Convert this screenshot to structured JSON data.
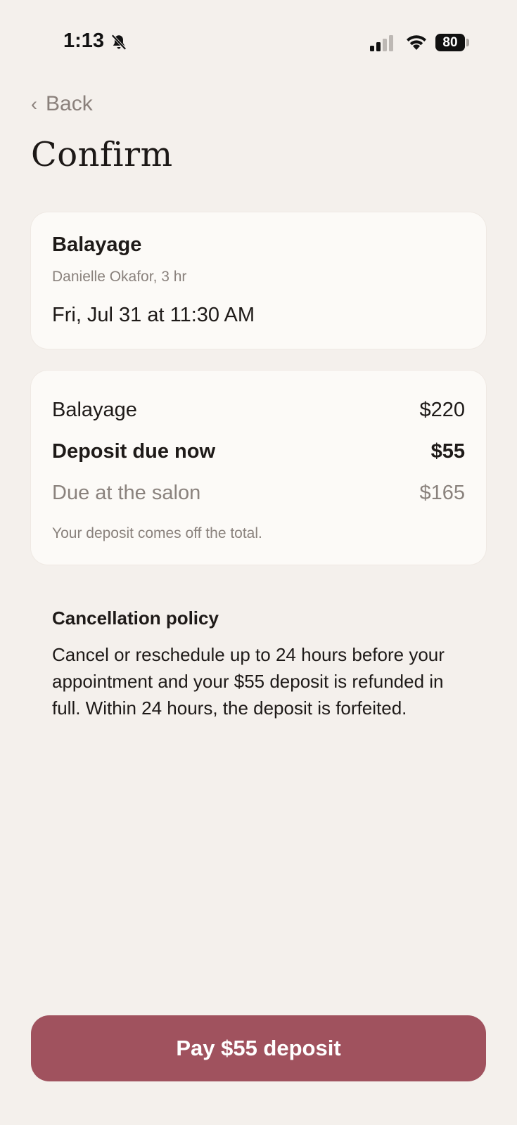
{
  "status": {
    "time": "1:13",
    "battery": "80",
    "icons": [
      "bell-slash-icon",
      "signal-icon",
      "wifi-icon",
      "battery-icon"
    ]
  },
  "nav": {
    "back_label": "Back"
  },
  "page": {
    "title": "Confirm"
  },
  "appointment": {
    "service": "Balayage",
    "stylist_line": "Danielle Okafor, 3 hr",
    "datetime": "Fri, Jul 31 at 11:30 AM"
  },
  "pricing": {
    "rows": [
      {
        "label": "Balayage",
        "amount": "$220"
      },
      {
        "label": "Deposit due now",
        "amount": "$55"
      },
      {
        "label": "Due at the salon",
        "amount": "$165"
      }
    ],
    "note": "Your deposit comes off the total."
  },
  "policy": {
    "title": "Cancellation policy",
    "body": "Cancel or reschedule up to 24 hours before your appointment and your $55 deposit is refunded in full. Within 24 hours, the deposit is forfeited."
  },
  "cta": {
    "label": "Pay $55 deposit",
    "color": "#a0525e"
  },
  "colors": {
    "background": "#f4f0ec",
    "card": "#fcfaf7",
    "muted": "#8a827d"
  }
}
